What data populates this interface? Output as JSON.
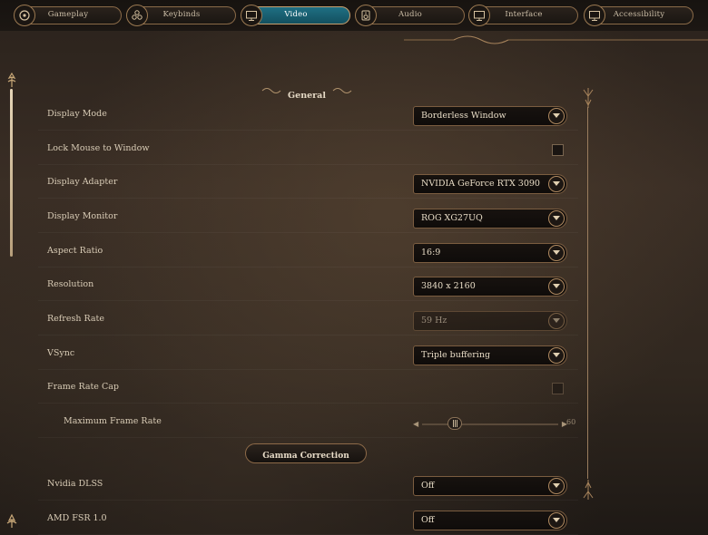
{
  "tabs": [
    {
      "label": "Gameplay",
      "icon": "gameplay-icon",
      "active": false
    },
    {
      "label": "Keybinds",
      "icon": "keybinds-icon",
      "active": false
    },
    {
      "label": "Video",
      "icon": "monitor-icon",
      "active": true
    },
    {
      "label": "Audio",
      "icon": "speaker-icon",
      "active": false
    },
    {
      "label": "Interface",
      "icon": "monitor-icon",
      "active": false
    },
    {
      "label": "Accessibility",
      "icon": "monitor-icon",
      "active": false
    }
  ],
  "section": {
    "title": "General"
  },
  "settings": {
    "display_mode": {
      "label": "Display Mode",
      "value": "Borderless Window"
    },
    "lock_mouse": {
      "label": "Lock Mouse to Window",
      "checked": false
    },
    "display_adapter": {
      "label": "Display Adapter",
      "value": "NVIDIA GeForce RTX 3090"
    },
    "display_monitor": {
      "label": "Display Monitor",
      "value": "ROG XG27UQ"
    },
    "aspect_ratio": {
      "label": "Aspect Ratio",
      "value": "16:9"
    },
    "resolution": {
      "label": "Resolution",
      "value": "3840 x 2160"
    },
    "refresh_rate": {
      "label": "Refresh Rate",
      "value": "59 Hz",
      "disabled": true
    },
    "vsync": {
      "label": "VSync",
      "value": "Triple buffering"
    },
    "frame_rate_cap": {
      "label": "Frame Rate Cap",
      "checked": false
    },
    "max_frame_rate": {
      "label": "Maximum Frame Rate",
      "value": "60"
    },
    "nvidia_dlss": {
      "label": "Nvidia DLSS",
      "value": "Off"
    },
    "amd_fsr": {
      "label": "AMD FSR 1.0",
      "value": "Off"
    }
  },
  "buttons": {
    "gamma_correction": "Gamma Correction"
  },
  "colors": {
    "accent": "#1f6f83",
    "gold": "#b08a60",
    "background": "#2a221c"
  }
}
